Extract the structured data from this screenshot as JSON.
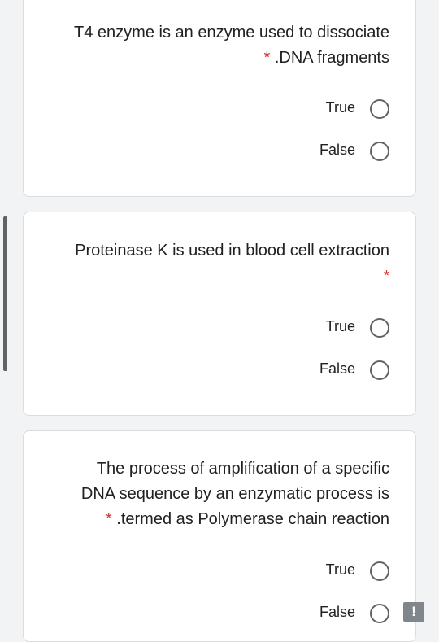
{
  "questions": [
    {
      "text_lines": [
        "T4 enzyme is an enzyme used to dissociate",
        ".DNA fragments"
      ],
      "required_mark": "*",
      "options": [
        {
          "label": "True",
          "selected": false
        },
        {
          "label": "False",
          "selected": false
        }
      ]
    },
    {
      "text_lines": [
        "Proteinase K is used in blood cell extraction"
      ],
      "required_mark": "*",
      "options": [
        {
          "label": "True",
          "selected": false
        },
        {
          "label": "False",
          "selected": false
        }
      ]
    },
    {
      "text_lines": [
        "The process of amplification of a specific",
        "DNA sequence by an enzymatic process is",
        ".termed as Polymerase chain reaction"
      ],
      "required_mark": "*",
      "options": [
        {
          "label": "True",
          "selected": false
        },
        {
          "label": "False",
          "selected": false
        }
      ]
    }
  ],
  "feedback": {
    "icon": "feedback-icon",
    "glyph": "!"
  },
  "colors": {
    "background": "#f1f3f4",
    "card": "#ffffff",
    "required": "#d93025",
    "radio_border": "#5f6368",
    "scroll_indicator": "#5f6368"
  }
}
